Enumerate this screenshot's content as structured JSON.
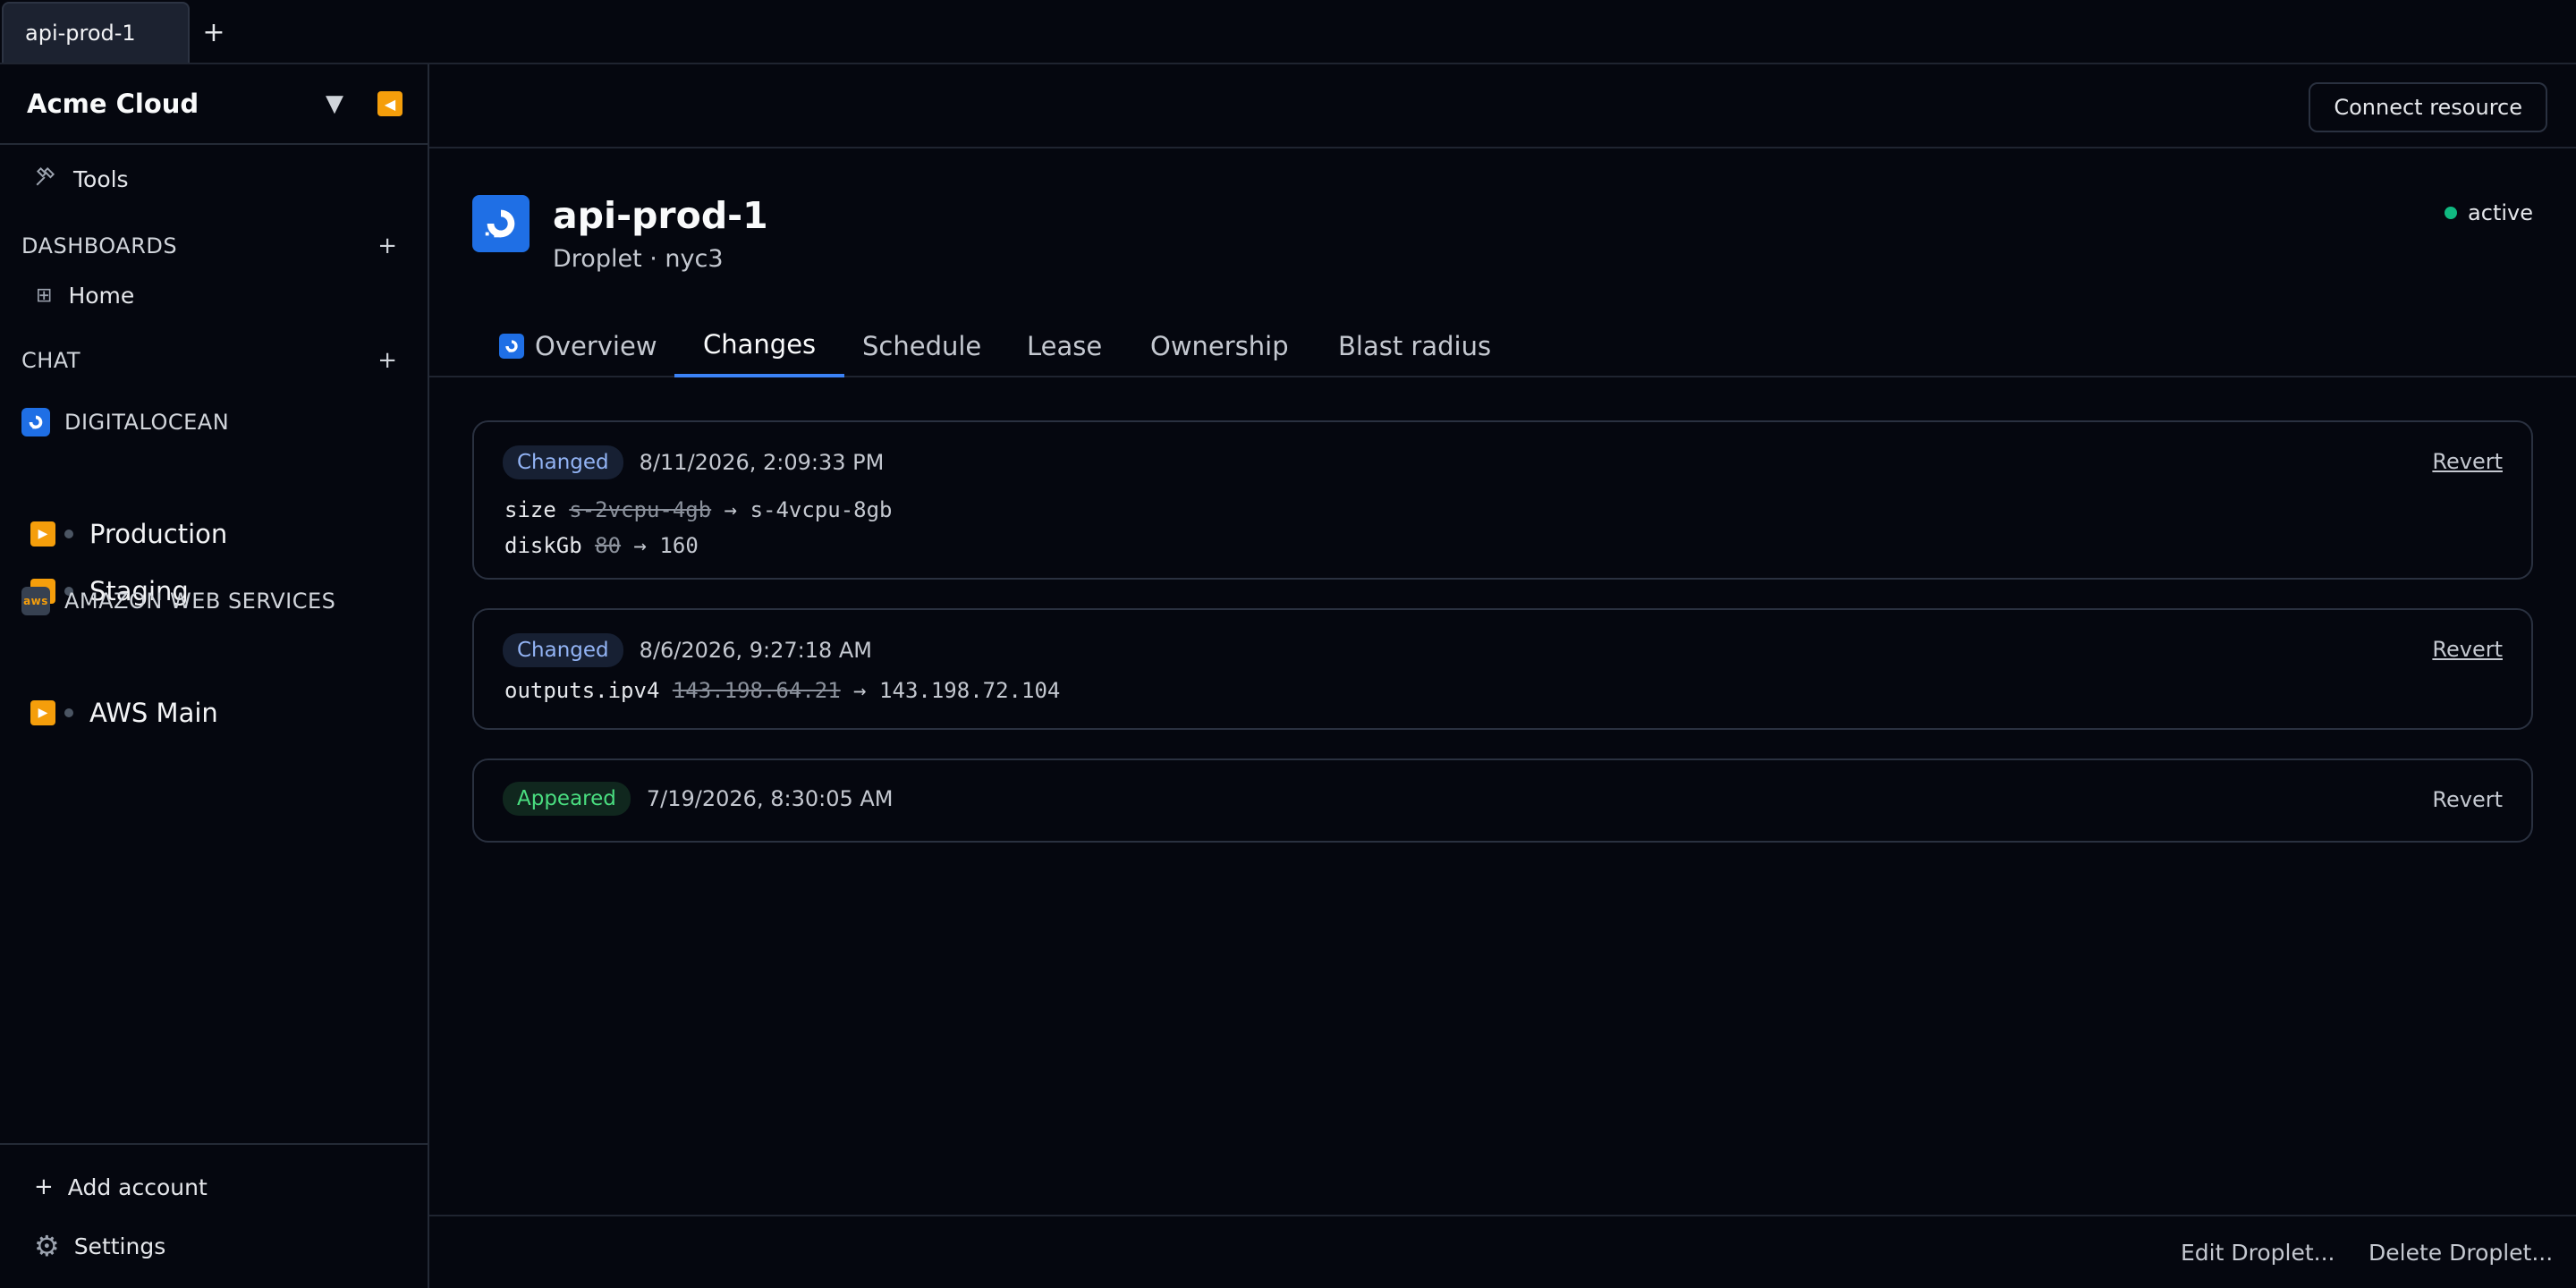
{
  "tabs": [
    {
      "label": "api-prod-1"
    }
  ],
  "tab_add": "+",
  "sidebar": {
    "org_name": "Acme Cloud",
    "org_caret": "▼",
    "tools_label": "Tools",
    "dashboards": {
      "title": "DASHBOARDS",
      "add": "+",
      "items": [
        {
          "label": "Home"
        }
      ]
    },
    "chat": {
      "title": "CHAT",
      "add": "+"
    },
    "providers": [
      {
        "name": "DIGITALOCEAN",
        "accounts": [
          {
            "label": "Production"
          },
          {
            "label": "Staging"
          }
        ]
      },
      {
        "name": "AMAZON WEB SERVICES",
        "icon_text": "aws",
        "accounts": [
          {
            "label": "AWS Main"
          }
        ]
      }
    ],
    "add_account": "Add account",
    "settings": "Settings"
  },
  "topbar": {
    "connect_label": "Connect resource"
  },
  "resource": {
    "title": "api-prod-1",
    "subtitle": "Droplet · nyc3",
    "status": "active",
    "status_color": "#10b981"
  },
  "resource_tabs": [
    {
      "label": "Overview"
    },
    {
      "label": "Changes",
      "active": true
    },
    {
      "label": "Schedule"
    },
    {
      "label": "Lease"
    },
    {
      "label": "Ownership"
    },
    {
      "label": "Blast radius"
    }
  ],
  "changes": [
    {
      "badge": "Changed",
      "time": "8/11/2026, 2:09:33 PM",
      "revert": "Revert",
      "diffs": [
        {
          "field": "size",
          "old": "s-2vcpu-4gb",
          "arrow": "→",
          "new": "s-4vcpu-8gb"
        },
        {
          "field": "diskGb",
          "old": "80",
          "arrow": "→",
          "new": "160"
        }
      ]
    },
    {
      "badge": "Changed",
      "time": "8/6/2026, 9:27:18 AM",
      "revert": "Revert",
      "diffs": [
        {
          "field": "outputs.ipv4",
          "old": "143.198.64.21",
          "arrow": "→",
          "new": "143.198.72.104"
        }
      ]
    },
    {
      "badge": "Appeared",
      "time": "7/19/2026, 8:30:05 AM",
      "revert": "Revert",
      "diffs": []
    }
  ],
  "footer": {
    "edit_label": "Edit Droplet...",
    "delete_label": "Delete Droplet..."
  },
  "colors": {
    "accent": "#3b82f6",
    "digitalocean": "#1f6fe5",
    "warning": "#f59e0b"
  }
}
